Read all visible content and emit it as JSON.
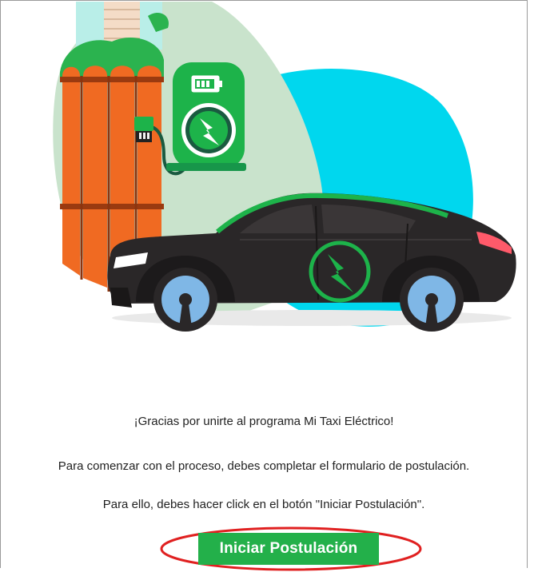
{
  "messages": {
    "thanks": "¡Gracias por unirte al programa Mi Taxi Eléctrico!",
    "start_process": "Para comenzar con el proceso, debes completar el formulario de postulación.",
    "instructions": "Para ello, debes hacer click en el botón \"Iniciar Postulación\"."
  },
  "cta": {
    "label": "Iniciar Postulación"
  },
  "illustration": {
    "icons": [
      "battery-icon",
      "lightning-bolt-icon",
      "charging-plug-icon",
      "electric-car-icon"
    ]
  },
  "colors": {
    "button_green": "#23b04a",
    "highlight_red": "#e02020",
    "brand_green": "#1db34a",
    "cyan_blob": "#00d7ee",
    "fence_orange": "#f06a22"
  }
}
